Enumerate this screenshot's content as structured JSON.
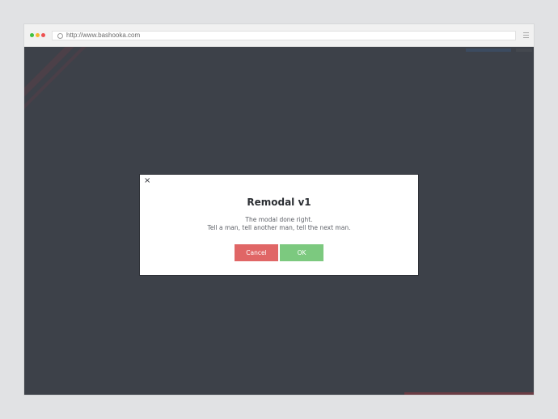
{
  "browser": {
    "url": "http://www.bashooka.com",
    "traffic_colors": {
      "green": "#3fc13f",
      "yellow": "#f5b731",
      "red": "#ee5151"
    },
    "menu_icon": "hamburger-icon",
    "address_icon": "search-icon"
  },
  "modal": {
    "close_label": "×",
    "title": "Remodal v1",
    "text_line1": "The modal done right.",
    "text_line2": "Tell a man, tell another man, tell the next man.",
    "cancel_label": "Cancel",
    "ok_label": "OK"
  },
  "colors": {
    "overlay": "#3d4149",
    "cancel": "#e06666",
    "ok": "#7cc97f"
  }
}
